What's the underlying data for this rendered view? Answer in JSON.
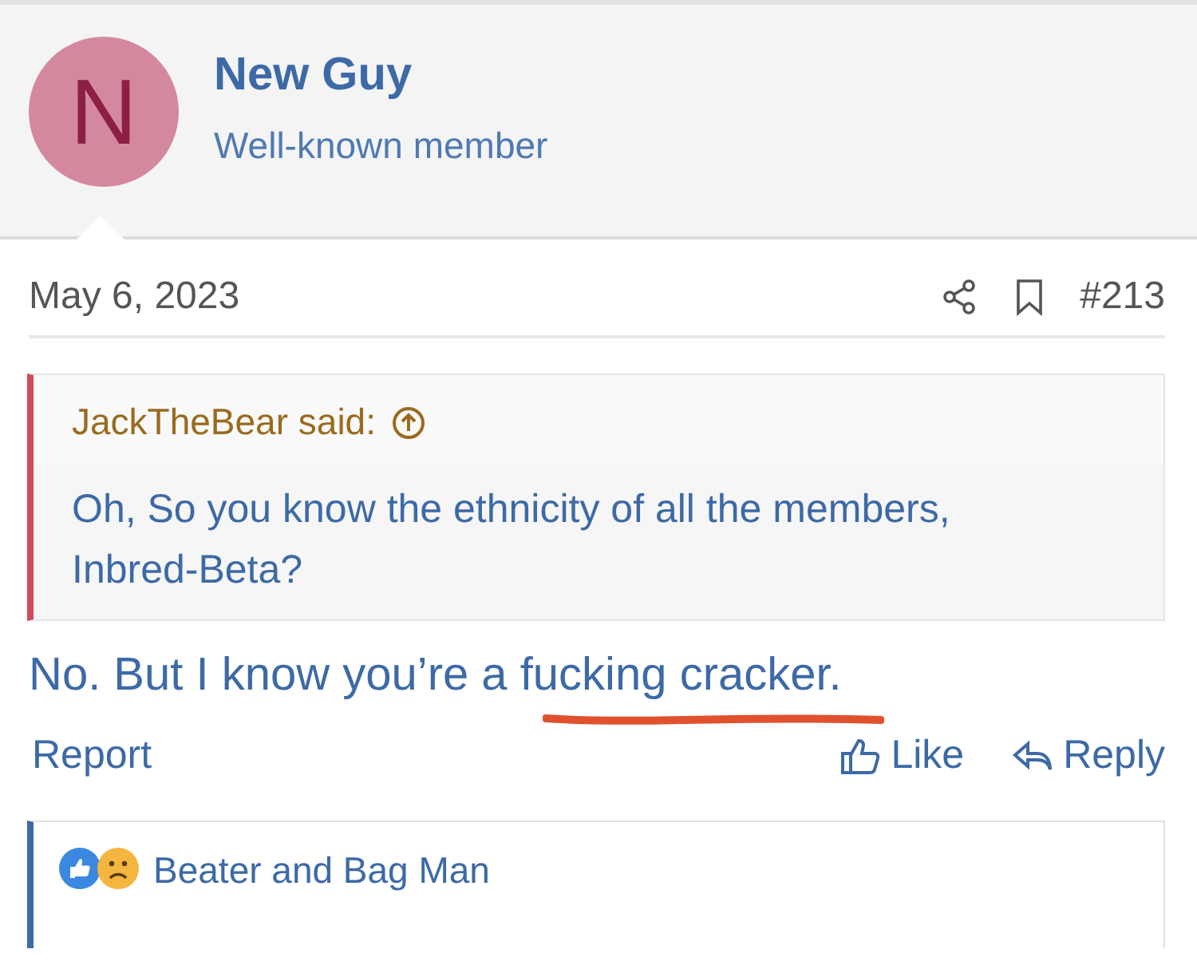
{
  "author": {
    "initial": "N",
    "name": "New Guy",
    "role": "Well-known member"
  },
  "post": {
    "date": "May 6, 2023",
    "number": "#213"
  },
  "quote": {
    "author_line": "JackTheBear said:",
    "text": "Oh, So you know the ethnicity of all the members, Inbred-Beta?"
  },
  "message": "No. But I know you’re a fucking cracker.",
  "actions": {
    "report": "Report",
    "like": "Like",
    "reply": "Reply"
  },
  "reactions": {
    "names": "Beater and Bag Man"
  }
}
